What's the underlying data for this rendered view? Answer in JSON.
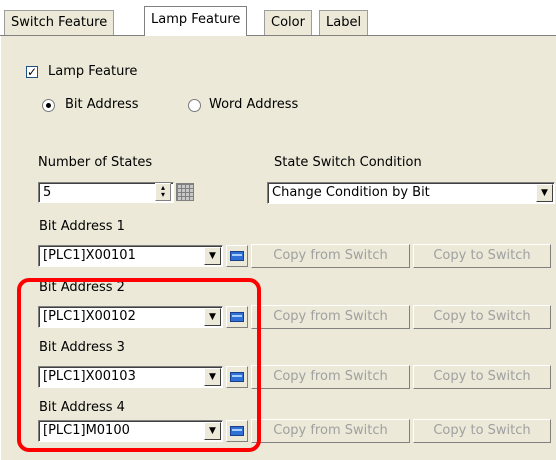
{
  "tabs": [
    {
      "label": "Switch Feature",
      "active": false
    },
    {
      "label": "Lamp Feature",
      "active": true
    },
    {
      "label": "Color",
      "active": false
    },
    {
      "label": "Label",
      "active": false
    }
  ],
  "lamp_feature": {
    "label": "Lamp Feature",
    "checked": true
  },
  "address_type": {
    "options": [
      "Bit Address",
      "Word Address"
    ],
    "selected": "Bit Address"
  },
  "number_of_states": {
    "label": "Number of States",
    "value": "5"
  },
  "state_switch_condition": {
    "label": "State Switch Condition",
    "value": "Change Condition by Bit"
  },
  "bit_addresses": [
    {
      "label": "Bit Address 1",
      "value": "[PLC1]X00101"
    },
    {
      "label": "Bit Address 2",
      "value": "[PLC1]X00102"
    },
    {
      "label": "Bit Address 3",
      "value": "[PLC1]X00103"
    },
    {
      "label": "Bit Address 4",
      "value": "[PLC1]M0100"
    }
  ],
  "buttons": {
    "copy_from": "Copy from Switch",
    "copy_to": "Copy to Switch"
  },
  "icons": {
    "dropdown": "chevron-down-icon",
    "keypad": "keypad-icon",
    "spin": "spin-updown-icon",
    "grid": "grid-icon"
  },
  "colors": {
    "highlight": "#ff0000",
    "dialog_bg": "#ece9d8"
  }
}
